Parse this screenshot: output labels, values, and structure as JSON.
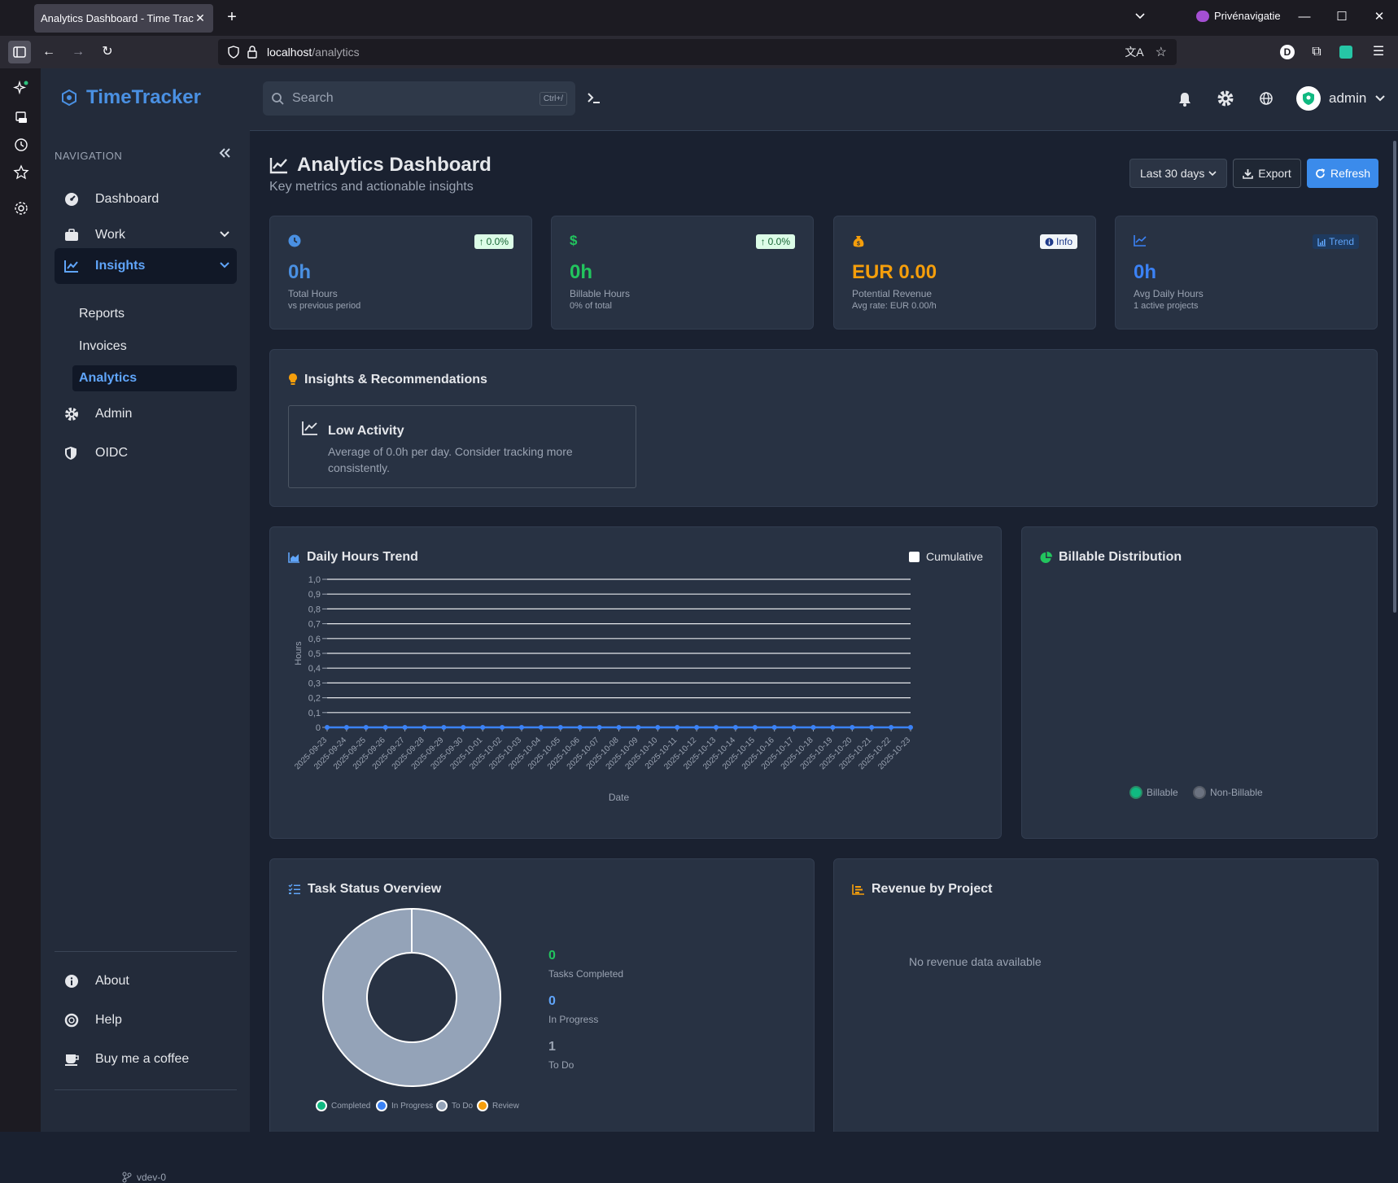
{
  "browser": {
    "tab_title": "Analytics Dashboard - Time Tracker",
    "private_label": "Privénavigatie",
    "url_host": "localhost",
    "url_path": "/analytics"
  },
  "app": {
    "brand": "TimeTracker",
    "search_placeholder": "Search",
    "search_shortcut": "Ctrl+/",
    "user_name": "admin"
  },
  "sidebar": {
    "heading": "NAVIGATION",
    "items": [
      {
        "label": "Dashboard",
        "icon": "dashboard-icon"
      },
      {
        "label": "Work",
        "icon": "briefcase-icon"
      },
      {
        "label": "Insights",
        "icon": "chart-line-icon"
      },
      {
        "label": "Admin",
        "icon": "gear-icon"
      },
      {
        "label": "OIDC",
        "icon": "shield-icon"
      }
    ],
    "subitems": [
      "Reports",
      "Invoices",
      "Analytics"
    ],
    "footer": [
      {
        "label": "About",
        "icon": "info-icon"
      },
      {
        "label": "Help",
        "icon": "lifebuoy-icon"
      },
      {
        "label": "Buy me a coffee",
        "icon": "coffee-icon"
      }
    ],
    "version": "vdev-0"
  },
  "page": {
    "title": "Analytics Dashboard",
    "subtitle": "Key metrics and actionable insights",
    "range": "Last 30 days",
    "export_label": "Export",
    "refresh_label": "Refresh"
  },
  "stats": [
    {
      "value": "0h",
      "label": "Total Hours",
      "sub": "vs previous period",
      "badge": "0.0%",
      "color": "#4a90e2"
    },
    {
      "value": "0h",
      "label": "Billable Hours",
      "sub": "0% of total",
      "badge": "0.0%",
      "color": "#22c55e"
    },
    {
      "value": "EUR 0.00",
      "label": "Potential Revenue",
      "sub": "Avg rate: EUR 0.00/h",
      "badge": "Info",
      "color": "#f59e0b"
    },
    {
      "value": "0h",
      "label": "Avg Daily Hours",
      "sub": "1 active projects",
      "badge": "Trend",
      "color": "#3b82f6"
    }
  ],
  "insights": {
    "title": "Insights & Recommendations",
    "item_title": "Low Activity",
    "item_text": "Average of 0.0h per day. Consider tracking more consistently."
  },
  "daily_trend": {
    "title": "Daily Hours Trend",
    "cumulative_label": "Cumulative"
  },
  "billable": {
    "title": "Billable Distribution",
    "legend": [
      "Billable",
      "Non-Billable"
    ]
  },
  "task_status": {
    "title": "Task Status Overview",
    "stats": [
      {
        "value": "0",
        "label": "Tasks Completed",
        "color": "#22c55e"
      },
      {
        "value": "0",
        "label": "In Progress",
        "color": "#60a5fa"
      },
      {
        "value": "1",
        "label": "To Do",
        "color": "#9aa3b2"
      }
    ],
    "legend": [
      {
        "label": "Completed",
        "color": "#10b981"
      },
      {
        "label": "In Progress",
        "color": "#3b82f6"
      },
      {
        "label": "To Do",
        "color": "#94a3b8"
      },
      {
        "label": "Review",
        "color": "#f59e0b"
      }
    ]
  },
  "revenue": {
    "title": "Revenue by Project",
    "empty": "No revenue data available"
  },
  "chart_data": [
    {
      "type": "line",
      "x": [
        "2025-09-23",
        "2025-09-24",
        "2025-09-25",
        "2025-09-26",
        "2025-09-27",
        "2025-09-28",
        "2025-09-29",
        "2025-09-30",
        "2025-10-01",
        "2025-10-02",
        "2025-10-03",
        "2025-10-04",
        "2025-10-05",
        "2025-10-06",
        "2025-10-07",
        "2025-10-08",
        "2025-10-09",
        "2025-10-10",
        "2025-10-11",
        "2025-10-12",
        "2025-10-13",
        "2025-10-14",
        "2025-10-15",
        "2025-10-16",
        "2025-10-17",
        "2025-10-18",
        "2025-10-19",
        "2025-10-20",
        "2025-10-21",
        "2025-10-22",
        "2025-10-23"
      ],
      "series": [
        {
          "values": [
            0,
            0,
            0,
            0,
            0,
            0,
            0,
            0,
            0,
            0,
            0,
            0,
            0,
            0,
            0,
            0,
            0,
            0,
            0,
            0,
            0,
            0,
            0,
            0,
            0,
            0,
            0,
            0,
            0,
            0,
            0
          ]
        }
      ],
      "yticks": [
        "0",
        "0,1",
        "0,2",
        "0,3",
        "0,4",
        "0,5",
        "0,6",
        "0,7",
        "0,8",
        "0,9",
        "1,0"
      ],
      "xlabel": "Date",
      "ylabel": "Hours",
      "ylim": [
        0,
        1
      ],
      "grid": true,
      "color": "#3b82f6"
    },
    {
      "type": "pie",
      "labels": [
        "Completed",
        "In Progress",
        "To Do",
        "Review"
      ],
      "values": [
        0,
        0,
        1,
        0
      ],
      "colors": [
        "#10b981",
        "#3b82f6",
        "#94a3b8",
        "#f59e0b"
      ]
    }
  ]
}
